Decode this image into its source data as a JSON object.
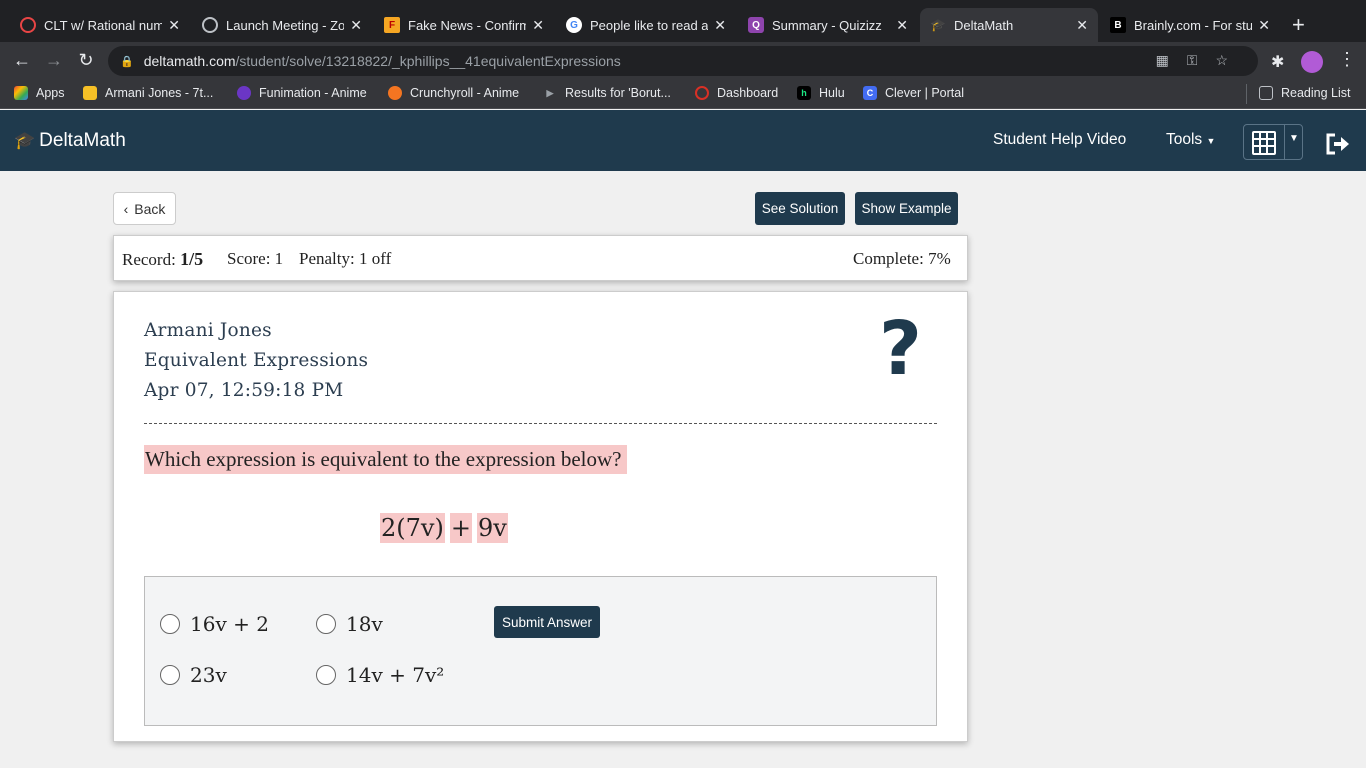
{
  "browser": {
    "tabs": [
      {
        "title": "CLT w/ Rational numl",
        "icon": "clt-icon",
        "color": "#e84545"
      },
      {
        "title": "Launch Meeting - Zo",
        "icon": "globe-icon",
        "color": "#bdc1c6"
      },
      {
        "title": "Fake News - Confirm",
        "icon": "f-icon",
        "color": "#f5a623"
      },
      {
        "title": "People like to read a",
        "icon": "google-icon",
        "color": "#ffffff"
      },
      {
        "title": "Summary - Quizizz",
        "icon": "quizizz-icon",
        "color": "#8e44ad"
      },
      {
        "title": "DeltaMath",
        "icon": "deltamath-icon",
        "color": "#bdc1c6"
      },
      {
        "title": "Brainly.com - For stu",
        "icon": "brainly-icon",
        "color": "#000000"
      }
    ],
    "url_host": "deltamath.com",
    "url_path": "/student/solve/13218822/_kphillips__41equivalentExpressions",
    "bookmarks": [
      {
        "label": "Apps",
        "icon": "apps-grid-icon"
      },
      {
        "label": "Armani Jones - 7t...",
        "icon": "folder-icon"
      },
      {
        "label": "Funimation - Anime",
        "icon": "funimation-icon"
      },
      {
        "label": "Crunchyroll - Anime",
        "icon": "crunchyroll-icon"
      },
      {
        "label": "Results for 'Borut...",
        "icon": "play-icon"
      },
      {
        "label": "Dashboard",
        "icon": "dashboard-icon"
      },
      {
        "label": "Hulu",
        "icon": "hulu-icon"
      },
      {
        "label": "Clever | Portal",
        "icon": "clever-icon"
      }
    ],
    "reading_list": "Reading List"
  },
  "app": {
    "brand": "DeltaMath",
    "nav_help": "Student Help Video",
    "nav_tools": "Tools",
    "accent": "#1f3a4d"
  },
  "page": {
    "back": "Back",
    "see_solution": "See Solution",
    "show_example": "Show Example",
    "record_label": "Record:",
    "record_value": "1/5",
    "score": "Score: 1",
    "penalty": "Penalty: 1 off",
    "complete": "Complete: 7%",
    "student_name": "Armani Jones",
    "assignment": "Equivalent Expressions",
    "timestamp": "Apr 07, 12:59:18 PM",
    "question": "Which expression is equivalent to the expression below?",
    "expression_parts": [
      "2(7v)",
      "+",
      "9v"
    ],
    "options": [
      "16v + 2",
      "18v",
      "23v",
      "14v + 7v²"
    ],
    "submit": "Submit Answer",
    "highlight_color": "#f7c8c8"
  }
}
